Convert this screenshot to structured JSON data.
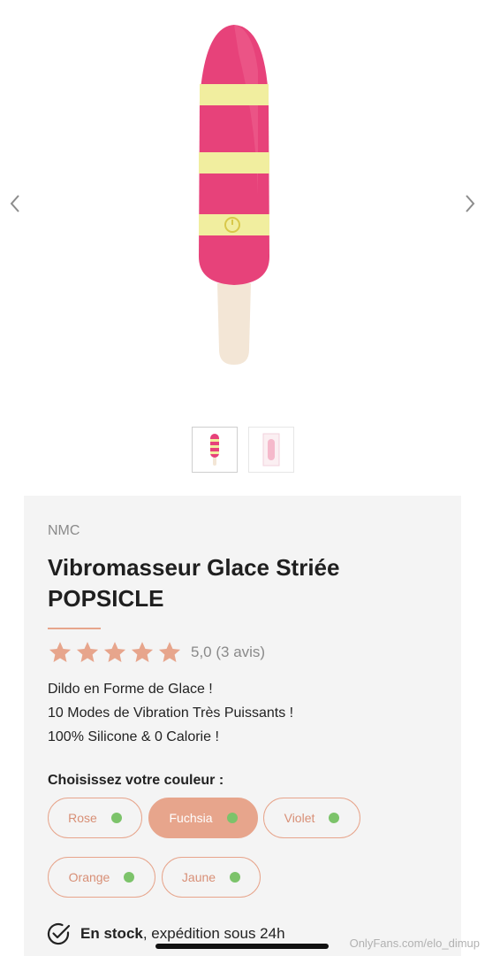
{
  "gallery": {
    "prev_icon": "chevron-left-icon",
    "next_icon": "chevron-right-icon",
    "thumb_count": 2,
    "active_thumb": 1
  },
  "product": {
    "brand": "NMC",
    "title_line1": "Vibromasseur Glace Striée",
    "title_line2": "POPSICLE",
    "rating": {
      "stars": 5,
      "text": "5,0 (3 avis)"
    },
    "description": [
      "Dildo en Forme de Glace !",
      "10 Modes de Vibration Très Puissants !",
      "100% Silicone & 0 Calorie !"
    ]
  },
  "colors": {
    "label": "Choisissez votre couleur :",
    "options": [
      {
        "label": "Rose",
        "available": true
      },
      {
        "label": "Fuchsia",
        "available": true,
        "selected": true
      },
      {
        "label": "Violet",
        "available": true
      },
      {
        "label": "Orange",
        "available": true
      },
      {
        "label": "Jaune",
        "available": true
      }
    ]
  },
  "stock": {
    "status": "En stock",
    "shipping": ", expédition sous 24h"
  },
  "watermark": "OnlyFans.com/elo_dimup",
  "theme": {
    "accent": "#e7a58c",
    "available_dot": "#7cc36a",
    "card_bg": "#f4f4f4"
  }
}
